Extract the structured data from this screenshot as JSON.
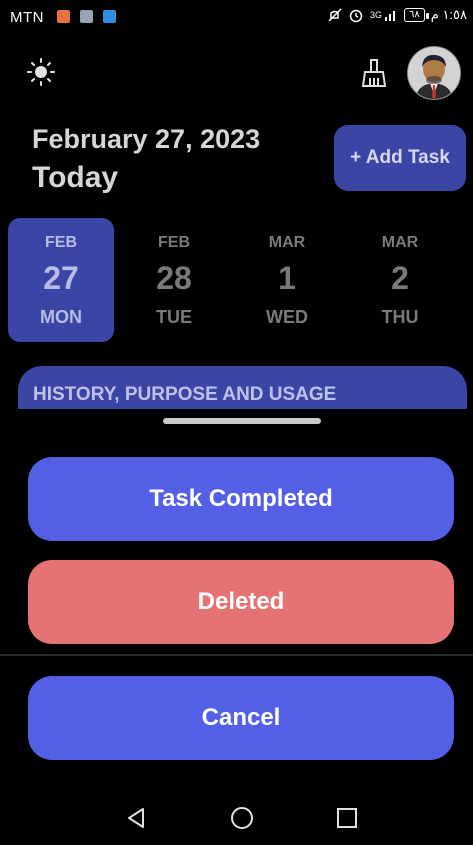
{
  "status_bar": {
    "carrier": "MTN",
    "network": "3G",
    "battery": "٦٨",
    "time": "١:٥٨ م"
  },
  "header": {
    "theme_icon": "sun-icon",
    "clean_icon": "broom-icon",
    "date": "February 27, 2023",
    "subtitle": "Today",
    "add_task_label": "+ Add Task"
  },
  "date_strip": [
    {
      "month": "FEB",
      "day": "27",
      "weekday": "MON",
      "selected": true
    },
    {
      "month": "FEB",
      "day": "28",
      "weekday": "TUE",
      "selected": false
    },
    {
      "month": "MAR",
      "day": "1",
      "weekday": "WED",
      "selected": false
    },
    {
      "month": "MAR",
      "day": "2",
      "weekday": "THU",
      "selected": false
    }
  ],
  "task_card": {
    "title": "HISTORY, PURPOSE AND USAGE"
  },
  "sheet": {
    "complete_label": "Task Completed",
    "delete_label": "Deleted",
    "cancel_label": "Cancel"
  },
  "colors": {
    "primary": "#5360e6",
    "danger": "#e57373",
    "selected_bg": "#3a45a6"
  },
  "nav_icons": [
    "back-icon",
    "home-icon",
    "recents-icon"
  ]
}
